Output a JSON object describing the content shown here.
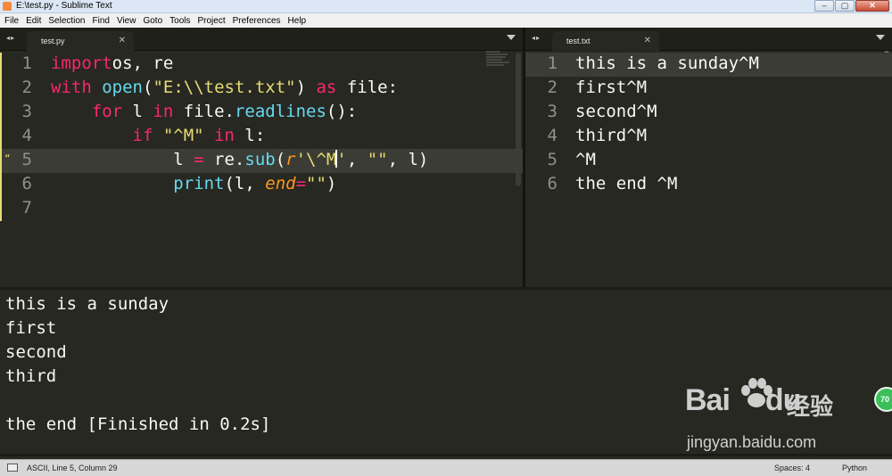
{
  "window": {
    "title": "E:\\test.py - Sublime Text"
  },
  "menu": [
    "File",
    "Edit",
    "Selection",
    "Find",
    "View",
    "Goto",
    "Tools",
    "Project",
    "Preferences",
    "Help"
  ],
  "left_pane": {
    "tab": "test.py",
    "line_numbers": [
      "1",
      "2",
      "3",
      "4",
      "5",
      "6",
      "7"
    ],
    "lines": [
      [
        [
          "kw",
          "import"
        ],
        [
          "",
          "os, re"
        ]
      ],
      [
        [
          "kw",
          "with"
        ],
        [
          "",
          " "
        ],
        [
          "fn",
          "open"
        ],
        [
          "",
          "("
        ],
        [
          "st",
          "\"E:\\\\test.txt\""
        ],
        [
          "",
          ") "
        ],
        [
          "kw",
          "as"
        ],
        [
          "",
          " file:"
        ]
      ],
      [
        [
          "",
          "    "
        ],
        [
          "kw",
          "for"
        ],
        [
          "",
          " l "
        ],
        [
          "kw",
          "in"
        ],
        [
          "",
          " file."
        ],
        [
          "fn",
          "readlines"
        ],
        [
          "",
          "():"
        ]
      ],
      [
        [
          "",
          "        "
        ],
        [
          "kw",
          "if"
        ],
        [
          "",
          " "
        ],
        [
          "st",
          "\"^M\""
        ],
        [
          "",
          " "
        ],
        [
          "kw",
          "in"
        ],
        [
          "",
          " l:"
        ]
      ],
      [
        [
          "",
          "            l "
        ],
        [
          "op",
          "="
        ],
        [
          "",
          " re."
        ],
        [
          "fn",
          "sub"
        ],
        [
          "",
          "("
        ],
        [
          "it",
          "r"
        ],
        [
          "st",
          "'\\^M"
        ],
        [
          "cursor",
          ""
        ],
        [
          "st",
          "'"
        ],
        [
          "",
          ", "
        ],
        [
          "st",
          "\"\""
        ],
        [
          "",
          ", l)"
        ]
      ],
      [
        [
          "",
          "            "
        ],
        [
          "fn",
          "print"
        ],
        [
          "",
          "(l, "
        ],
        [
          "it",
          "end"
        ],
        [
          "op",
          "="
        ],
        [
          "st",
          "\"\""
        ],
        [
          "",
          ")"
        ]
      ],
      []
    ],
    "highlighted_line": 5
  },
  "right_pane": {
    "tab": "test.txt",
    "line_numbers": [
      "1",
      "2",
      "3",
      "4",
      "5",
      "6"
    ],
    "lines": [
      "this is a sunday^M",
      "first^M",
      "second^M",
      "third^M",
      "^M",
      "the end ^M"
    ]
  },
  "output": [
    "this is a sunday",
    "first",
    "second",
    "third",
    "",
    "the end [Finished in 0.2s]"
  ],
  "badge": "70",
  "watermark": {
    "logo": "Bai",
    "logo_end": "du",
    "cn": "经验",
    "url": "jingyan.baidu.com"
  },
  "status": {
    "position": "ASCII, Line 5, Column 29",
    "spaces": "Spaces: 4",
    "syntax": "Python"
  },
  "colors": {
    "background": "#272822",
    "keyword": "#f92672",
    "function": "#66d9ef",
    "string": "#e6db74",
    "parameter": "#fd971f",
    "line_number": "#8f908a",
    "text": "#f8f8f2"
  }
}
